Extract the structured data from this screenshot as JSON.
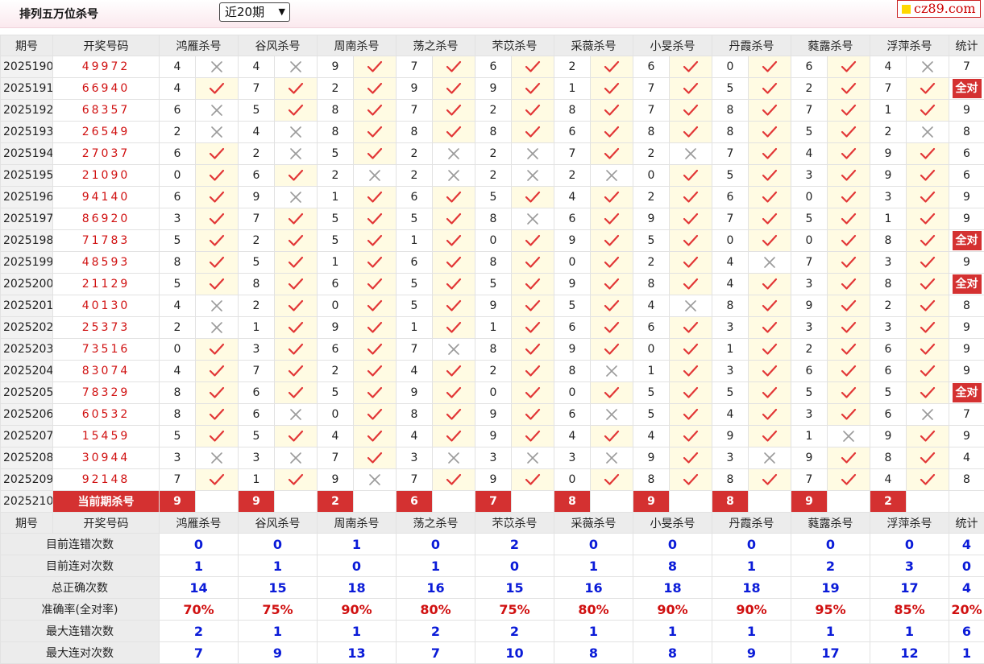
{
  "header": {
    "title": "排列五万位杀号",
    "period_select": "近20期",
    "logo": "cz89.com"
  },
  "table": {
    "col_period": "期号",
    "col_draw": "开奖号码",
    "col_stat": "统计",
    "experts": [
      "鸿雁杀号",
      "谷风杀号",
      "周南杀号",
      "荡之杀号",
      "芣苡杀号",
      "采薇杀号",
      "小旻杀号",
      "丹霞杀号",
      "蕤露杀号",
      "浮萍杀号"
    ],
    "rows": [
      {
        "period": "2025190",
        "draw": "49972",
        "kills": [
          4,
          4,
          9,
          7,
          6,
          2,
          6,
          0,
          6,
          4
        ],
        "ok": [
          0,
          0,
          1,
          1,
          1,
          1,
          1,
          1,
          1,
          0
        ],
        "stat": "7"
      },
      {
        "period": "2025191",
        "draw": "66940",
        "kills": [
          4,
          7,
          2,
          9,
          9,
          1,
          7,
          5,
          2,
          7
        ],
        "ok": [
          1,
          1,
          1,
          1,
          1,
          1,
          1,
          1,
          1,
          1
        ],
        "stat": "全对"
      },
      {
        "period": "2025192",
        "draw": "68357",
        "kills": [
          6,
          5,
          8,
          7,
          2,
          8,
          7,
          8,
          7,
          1
        ],
        "ok": [
          0,
          1,
          1,
          1,
          1,
          1,
          1,
          1,
          1,
          1
        ],
        "stat": "9"
      },
      {
        "period": "2025193",
        "draw": "26549",
        "kills": [
          2,
          4,
          8,
          8,
          8,
          6,
          8,
          8,
          5,
          2
        ],
        "ok": [
          0,
          0,
          1,
          1,
          1,
          1,
          1,
          1,
          1,
          0
        ],
        "stat": "8"
      },
      {
        "period": "2025194",
        "draw": "27037",
        "kills": [
          6,
          2,
          5,
          2,
          2,
          7,
          2,
          7,
          4,
          9
        ],
        "ok": [
          1,
          0,
          1,
          0,
          0,
          1,
          0,
          1,
          1,
          1
        ],
        "stat": "6"
      },
      {
        "period": "2025195",
        "draw": "21090",
        "kills": [
          0,
          6,
          2,
          2,
          2,
          2,
          0,
          5,
          3,
          9
        ],
        "ok": [
          1,
          1,
          0,
          0,
          0,
          0,
          1,
          1,
          1,
          1
        ],
        "stat": "6"
      },
      {
        "period": "2025196",
        "draw": "94140",
        "kills": [
          6,
          9,
          1,
          6,
          5,
          4,
          2,
          6,
          0,
          3
        ],
        "ok": [
          1,
          0,
          1,
          1,
          1,
          1,
          1,
          1,
          1,
          1
        ],
        "stat": "9"
      },
      {
        "period": "2025197",
        "draw": "86920",
        "kills": [
          3,
          7,
          5,
          5,
          8,
          6,
          9,
          7,
          5,
          1
        ],
        "ok": [
          1,
          1,
          1,
          1,
          0,
          1,
          1,
          1,
          1,
          1
        ],
        "stat": "9"
      },
      {
        "period": "2025198",
        "draw": "71783",
        "kills": [
          5,
          2,
          5,
          1,
          0,
          9,
          5,
          0,
          0,
          8
        ],
        "ok": [
          1,
          1,
          1,
          1,
          1,
          1,
          1,
          1,
          1,
          1
        ],
        "stat": "全对"
      },
      {
        "period": "2025199",
        "draw": "48593",
        "kills": [
          8,
          5,
          1,
          6,
          8,
          0,
          2,
          4,
          7,
          3
        ],
        "ok": [
          1,
          1,
          1,
          1,
          1,
          1,
          1,
          0,
          1,
          1
        ],
        "stat": "9"
      },
      {
        "period": "2025200",
        "draw": "21129",
        "kills": [
          5,
          8,
          6,
          5,
          5,
          9,
          8,
          4,
          3,
          8
        ],
        "ok": [
          1,
          1,
          1,
          1,
          1,
          1,
          1,
          1,
          1,
          1
        ],
        "stat": "全对"
      },
      {
        "period": "2025201",
        "draw": "40130",
        "kills": [
          4,
          2,
          0,
          5,
          9,
          5,
          4,
          8,
          9,
          2
        ],
        "ok": [
          0,
          1,
          1,
          1,
          1,
          1,
          0,
          1,
          1,
          1
        ],
        "stat": "8"
      },
      {
        "period": "2025202",
        "draw": "25373",
        "kills": [
          2,
          1,
          9,
          1,
          1,
          6,
          6,
          3,
          3,
          3
        ],
        "ok": [
          0,
          1,
          1,
          1,
          1,
          1,
          1,
          1,
          1,
          1
        ],
        "stat": "9"
      },
      {
        "period": "2025203",
        "draw": "73516",
        "kills": [
          0,
          3,
          6,
          7,
          8,
          9,
          0,
          1,
          2,
          6
        ],
        "ok": [
          1,
          1,
          1,
          0,
          1,
          1,
          1,
          1,
          1,
          1
        ],
        "stat": "9"
      },
      {
        "period": "2025204",
        "draw": "83074",
        "kills": [
          4,
          7,
          2,
          4,
          2,
          8,
          1,
          3,
          6,
          6
        ],
        "ok": [
          1,
          1,
          1,
          1,
          1,
          0,
          1,
          1,
          1,
          1
        ],
        "stat": "9"
      },
      {
        "period": "2025205",
        "draw": "78329",
        "kills": [
          8,
          6,
          5,
          9,
          0,
          0,
          5,
          5,
          5,
          5
        ],
        "ok": [
          1,
          1,
          1,
          1,
          1,
          1,
          1,
          1,
          1,
          1
        ],
        "stat": "全对"
      },
      {
        "period": "2025206",
        "draw": "60532",
        "kills": [
          8,
          6,
          0,
          8,
          9,
          6,
          5,
          4,
          3,
          6
        ],
        "ok": [
          1,
          0,
          1,
          1,
          1,
          0,
          1,
          1,
          1,
          0
        ],
        "stat": "7"
      },
      {
        "period": "2025207",
        "draw": "15459",
        "kills": [
          5,
          5,
          4,
          4,
          9,
          4,
          4,
          9,
          1,
          9
        ],
        "ok": [
          1,
          1,
          1,
          1,
          1,
          1,
          1,
          1,
          0,
          1
        ],
        "stat": "9"
      },
      {
        "period": "2025208",
        "draw": "30944",
        "kills": [
          3,
          3,
          7,
          3,
          3,
          3,
          9,
          3,
          9,
          8
        ],
        "ok": [
          0,
          0,
          1,
          0,
          0,
          0,
          1,
          0,
          1,
          1
        ],
        "stat": "4"
      },
      {
        "period": "2025209",
        "draw": "92148",
        "kills": [
          7,
          1,
          9,
          7,
          9,
          0,
          8,
          8,
          7,
          4
        ],
        "ok": [
          1,
          1,
          0,
          1,
          1,
          1,
          1,
          1,
          1,
          1
        ],
        "stat": "8"
      }
    ],
    "current": {
      "period": "2025210",
      "label": "当前期杀号",
      "kills": [
        "9",
        "9",
        "2",
        "6",
        "7",
        "8",
        "9",
        "8",
        "9",
        "2"
      ]
    },
    "stats": [
      {
        "label": "目前连错次数",
        "values": [
          "0",
          "0",
          "1",
          "0",
          "2",
          "0",
          "0",
          "0",
          "0",
          "0"
        ],
        "total": "4",
        "pct": false
      },
      {
        "label": "目前连对次数",
        "values": [
          "1",
          "1",
          "0",
          "1",
          "0",
          "1",
          "8",
          "1",
          "2",
          "3"
        ],
        "total": "0",
        "pct": false
      },
      {
        "label": "总正确次数",
        "values": [
          "14",
          "15",
          "18",
          "16",
          "15",
          "16",
          "18",
          "18",
          "19",
          "17"
        ],
        "total": "4",
        "pct": false
      },
      {
        "label": "准确率(全对率)",
        "values": [
          "70%",
          "75%",
          "90%",
          "80%",
          "75%",
          "80%",
          "90%",
          "90%",
          "95%",
          "85%"
        ],
        "total": "20%",
        "pct": true
      },
      {
        "label": "最大连错次数",
        "values": [
          "2",
          "1",
          "1",
          "2",
          "2",
          "1",
          "1",
          "1",
          "1",
          "1"
        ],
        "total": "6",
        "pct": false
      },
      {
        "label": "最大连对次数",
        "values": [
          "7",
          "9",
          "13",
          "7",
          "10",
          "8",
          "8",
          "9",
          "17",
          "12"
        ],
        "total": "1",
        "pct": false
      }
    ]
  },
  "colors": {
    "accent_red": "#d43131",
    "pass_yellow": "#fffbe3",
    "stat_blue": "#0a1bd8"
  },
  "icons": {
    "ok": "check-icon",
    "fail": "cross-icon"
  }
}
